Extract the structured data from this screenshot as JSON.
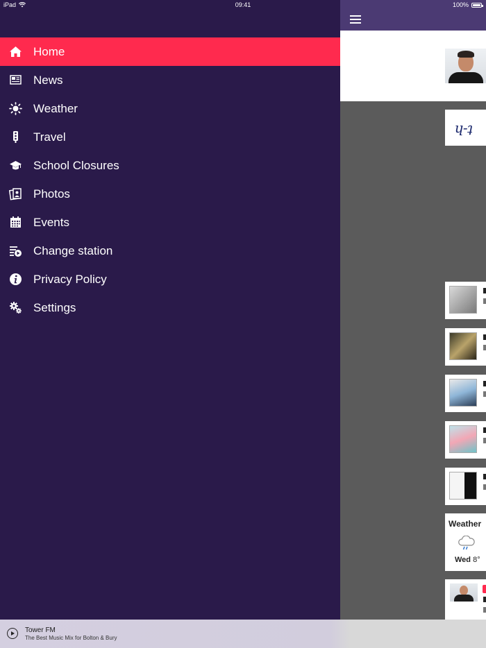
{
  "status_bar": {
    "device": "iPad",
    "time": "09:41",
    "battery": "100%"
  },
  "menu": {
    "items": [
      {
        "label": "Home",
        "icon": "home-icon",
        "active": true
      },
      {
        "label": "News",
        "icon": "news-icon"
      },
      {
        "label": "Weather",
        "icon": "sun-icon"
      },
      {
        "label": "Travel",
        "icon": "traffic-light-icon"
      },
      {
        "label": "School Closures",
        "icon": "graduation-cap-icon"
      },
      {
        "label": "Photos",
        "icon": "photos-icon"
      },
      {
        "label": "Events",
        "icon": "calendar-icon"
      },
      {
        "label": "Change station",
        "icon": "change-station-icon"
      },
      {
        "label": "Privacy Policy",
        "icon": "info-icon"
      },
      {
        "label": "Settings",
        "icon": "gear-icon"
      }
    ]
  },
  "content": {
    "weather_title": "Weather",
    "weather_day": "Wed",
    "weather_temp": "8°"
  },
  "player": {
    "station_name": "Tower FM",
    "tagline": "The Best Music Mix for Bolton & Bury"
  },
  "colors": {
    "drawer_bg": "#2a1a4a",
    "active_item": "#ff2a4e",
    "header_bg": "#4b3a73"
  }
}
